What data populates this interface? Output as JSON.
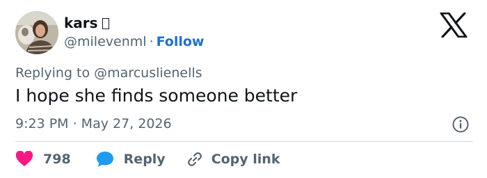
{
  "user": {
    "display_name": "kars",
    "handle": "@milevenml",
    "separator": "·",
    "follow_label": "Follow"
  },
  "tweet": {
    "reply_context": "Replying to @marcuslienells",
    "text": "I hope she finds someone better",
    "timestamp": "9:23 PM · May 27, 2026"
  },
  "actions": {
    "like_count": "798",
    "reply_label": "Reply",
    "copy_link_label": "Copy link"
  },
  "icons": {
    "logo": "x-logo-icon",
    "info": "info-icon",
    "like": "heart-icon",
    "reply": "speech-bubble-icon",
    "copy": "link-icon"
  },
  "colors": {
    "like": "#f91880",
    "reply": "#1d9bf0",
    "follow": "#1d6fd6",
    "secondary_text": "#536471",
    "primary_text": "#0f1419"
  }
}
